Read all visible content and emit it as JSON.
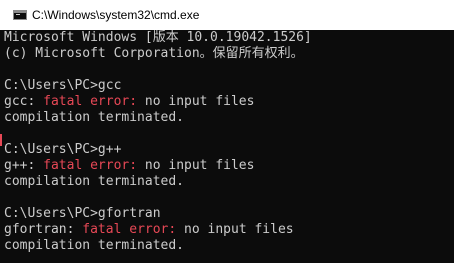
{
  "window": {
    "title": "C:\\Windows\\system32\\cmd.exe",
    "icon": "console-window-icon"
  },
  "console": {
    "lines": [
      {
        "text": "Microsoft Windows [版本 10.0.19042.1526]"
      },
      {
        "text": "(c) Microsoft Corporation。保留所有权利。"
      },
      {
        "text": ""
      },
      {
        "text": "C:\\Users\\PC>gcc"
      },
      {
        "pre": "gcc: ",
        "err": "fatal error:",
        "post": " no input files"
      },
      {
        "text": "compilation terminated."
      },
      {
        "text": ""
      },
      {
        "text": "C:\\Users\\PC>g++"
      },
      {
        "pre": "g++: ",
        "err": "fatal error:",
        "post": " no input files"
      },
      {
        "text": "compilation terminated."
      },
      {
        "text": ""
      },
      {
        "text": "C:\\Users\\PC>gfortran"
      },
      {
        "pre": "gfortran: ",
        "err": "fatal error:",
        "post": " no input files"
      },
      {
        "text": "compilation terminated."
      }
    ]
  },
  "colors": {
    "background": "#0c0c0c",
    "foreground": "#cccccc",
    "error": "#e74856",
    "titlebar": "#ffffff"
  }
}
